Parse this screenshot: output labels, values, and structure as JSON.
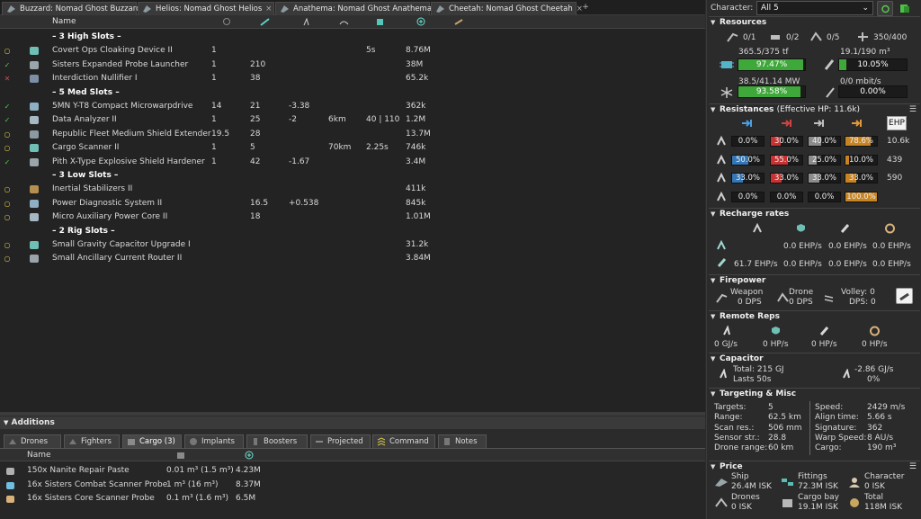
{
  "tabs": [
    {
      "label": "Buzzard: Nomad Ghost Buzzard",
      "icon": "ship-icon"
    },
    {
      "label": "Helios: Nomad Ghost Helios",
      "icon": "ship-icon"
    },
    {
      "label": "Anathema: Nomad Ghost Anathema",
      "icon": "ship-icon"
    },
    {
      "label": "Cheetah: Nomad Ghost Cheetah",
      "icon": "ship-icon"
    }
  ],
  "tab_close": "×",
  "tab_add": "+",
  "module_columns": {
    "name": "Name"
  },
  "modules": [
    {
      "state": "",
      "name": "– 3 High Slots –",
      "header": true
    },
    {
      "state": "online",
      "name": "Covert Ops Cloaking Device II",
      "qty": "1",
      "c1": "",
      "c2": "",
      "c3": "",
      "c4": "5s",
      "price": "8.76M"
    },
    {
      "state": "active",
      "name": "Sisters Expanded Probe Launcher",
      "qty": "1",
      "c1": "210",
      "c2": "",
      "c3": "",
      "c4": "",
      "price": "38M"
    },
    {
      "state": "offline",
      "name": "Interdiction Nullifier I",
      "qty": "1",
      "c1": "38",
      "c2": "",
      "c3": "",
      "c4": "",
      "price": "65.2k"
    },
    {
      "state": "",
      "name": "– 5 Med Slots –",
      "header": true
    },
    {
      "state": "active",
      "name": "5MN Y-T8 Compact Microwarpdrive",
      "qty": "14",
      "c1": "21",
      "c2": "-3.38",
      "c3": "",
      "c4": "",
      "price": "362k"
    },
    {
      "state": "active",
      "name": "Data Analyzer II",
      "qty": "1",
      "c1": "25",
      "c2": "-2",
      "c3": "6km",
      "c4": "40 | 110",
      "price": "1.2M"
    },
    {
      "state": "online",
      "name": "Republic Fleet Medium Shield Extender",
      "qty": "19.5",
      "c1": "28",
      "c2": "",
      "c3": "",
      "c4": "",
      "price": "13.7M"
    },
    {
      "state": "online",
      "name": "Cargo Scanner II",
      "qty": "1",
      "c1": "5",
      "c2": "",
      "c3": "70km",
      "c4": "2.25s",
      "price": "746k"
    },
    {
      "state": "active",
      "name": "Pith X-Type Explosive Shield Hardener",
      "qty": "1",
      "c1": "42",
      "c2": "-1.67",
      "c3": "",
      "c4": "",
      "price": "3.4M"
    },
    {
      "state": "",
      "name": "– 3 Low Slots –",
      "header": true
    },
    {
      "state": "online",
      "name": "Inertial Stabilizers II",
      "qty": "",
      "c1": "",
      "c2": "",
      "c3": "",
      "c4": "",
      "price": "411k"
    },
    {
      "state": "online",
      "name": "Power Diagnostic System II",
      "qty": "",
      "c1": "16.5",
      "c2": "+0.538",
      "c3": "",
      "c4": "",
      "price": "845k"
    },
    {
      "state": "online",
      "name": "Micro Auxiliary Power Core II",
      "qty": "",
      "c1": "18",
      "c2": "",
      "c3": "",
      "c4": "",
      "price": "1.01M"
    },
    {
      "state": "",
      "name": "– 2 Rig Slots –",
      "header": true
    },
    {
      "state": "online",
      "name": "Small Gravity Capacitor Upgrade I",
      "qty": "",
      "c1": "",
      "c2": "",
      "c3": "",
      "c4": "",
      "price": "31.2k"
    },
    {
      "state": "online",
      "name": "Small Ancillary Current Router II",
      "qty": "",
      "c1": "",
      "c2": "",
      "c3": "",
      "c4": "",
      "price": "3.84M"
    }
  ],
  "state_glyphs": {
    "online": "○",
    "active": "✓",
    "offline": "✕"
  },
  "additions": {
    "title": "Additions",
    "toggle": "▼",
    "tabs": [
      "Drones",
      "Fighters",
      "Cargo (3)",
      "Implants",
      "Boosters",
      "Projected",
      "Command",
      "Notes"
    ],
    "active_tab": "Cargo (3)",
    "columns": {
      "name": "Name"
    },
    "rows": [
      {
        "name": "150x Nanite Repair Paste",
        "volume": "0.01 m³ (1.5 m³)",
        "price": "4.23M"
      },
      {
        "name": "16x Sisters Combat Scanner Probe",
        "volume": "1 m³ (16 m³)",
        "price": "8.37M"
      },
      {
        "name": "16x Sisters Core Scanner Probe",
        "volume": "0.1 m³ (1.6 m³)",
        "price": "6.5M"
      }
    ]
  },
  "character": {
    "label": "Character:",
    "value": "All 5"
  },
  "resources": {
    "title": "Resources",
    "hardpoints": [
      {
        "icon": "turret-hardpoint-icon",
        "value": "0/1"
      },
      {
        "icon": "launcher-hardpoint-icon",
        "value": "0/2"
      },
      {
        "icon": "drone-bay-icon",
        "value": "0/5"
      },
      {
        "icon": "calibration-icon",
        "value": "350/400"
      }
    ],
    "cpu": {
      "text": "365.5/375 tf",
      "percent": "97.47%",
      "fill": 97.47
    },
    "pg": {
      "text": "38.5/41.14 MW",
      "percent": "93.58%",
      "fill": 93.58
    },
    "drone_bay": {
      "text": "19.1/190 m³",
      "percent": "10.05%",
      "fill": 10.05
    },
    "bandwidth": {
      "text": "0/0 mbit/s",
      "percent": "0.00%",
      "fill": 0
    }
  },
  "resistances": {
    "title": "Resistances",
    "ehp_label": "(Effective HP: 11.6k)",
    "ehp_button": "EHP",
    "menu": "☰",
    "rows": [
      {
        "layer": "shield",
        "values": [
          "0.0%",
          "30.0%",
          "40.0%",
          "78.6%"
        ],
        "fills": [
          0,
          30,
          40,
          78.6
        ],
        "hp": "10.6k"
      },
      {
        "layer": "armor",
        "values": [
          "50.0%",
          "55.0%",
          "25.0%",
          "10.0%"
        ],
        "fills": [
          50,
          55,
          25,
          10
        ],
        "hp": "439"
      },
      {
        "layer": "hull",
        "values": [
          "33.0%",
          "33.0%",
          "33.0%",
          "33.0%"
        ],
        "fills": [
          33,
          33,
          33,
          33
        ],
        "hp": "590"
      },
      {
        "layer": "damage-pattern",
        "values": [
          "0.0%",
          "0.0%",
          "0.0%",
          "100.0%"
        ],
        "fills": [
          0,
          0,
          0,
          100
        ],
        "hp": ""
      }
    ],
    "colors": [
      "#3577b5",
      "#c73232",
      "#8c8c8c",
      "#c98422"
    ]
  },
  "recharge": {
    "title": "Recharge rates",
    "rows": [
      {
        "values": [
          "0.0 EHP/s",
          "0.0 EHP/s",
          "0.0 EHP/s"
        ]
      },
      {
        "values": [
          "61.7 EHP/s",
          "0.0 EHP/s",
          "0.0 EHP/s",
          "0.0 EHP/s"
        ]
      }
    ]
  },
  "firepower": {
    "title": "Firepower",
    "weapon_label": "Weapon",
    "weapon_value": "0 DPS",
    "drone_label": "Drone",
    "drone_value": "0 DPS",
    "volley_label": "Volley: 0",
    "dps_label": "DPS: 0"
  },
  "remote_reps": {
    "title": "Remote Reps",
    "values": [
      "0 GJ/s",
      "0 HP/s",
      "0 HP/s",
      "0 HP/s"
    ]
  },
  "capacitor": {
    "title": "Capacitor",
    "total": "Total: 215 GJ",
    "lasts": "Lasts 50s",
    "rate": "-2.86 GJ/s",
    "rate_pct": "0%"
  },
  "targeting": {
    "title": "Targeting & Misc",
    "left": [
      {
        "label": "Targets:",
        "value": "5"
      },
      {
        "label": "Range:",
        "value": "62.5 km"
      },
      {
        "label": "Scan res.:",
        "value": "506 mm"
      },
      {
        "label": "Sensor str.:",
        "value": "28.8"
      },
      {
        "label": "Drone range:",
        "value": "60 km"
      }
    ],
    "right": [
      {
        "label": "Speed:",
        "value": "2429 m/s"
      },
      {
        "label": "Align time:",
        "value": "5.66 s"
      },
      {
        "label": "Signature:",
        "value": "362"
      },
      {
        "label": "Warp Speed:",
        "value": "8 AU/s"
      },
      {
        "label": "Cargo:",
        "value": "190 m³"
      }
    ]
  },
  "price": {
    "title": "Price",
    "items": [
      {
        "label": "Ship",
        "value": "26.4M ISK"
      },
      {
        "label": "Fittings",
        "value": "72.3M ISK"
      },
      {
        "label": "Character",
        "value": "0 ISK"
      },
      {
        "label": "Drones",
        "value": "0 ISK"
      },
      {
        "label": "Cargo bay",
        "value": "19.1M ISK"
      },
      {
        "label": "Total",
        "value": "118M ISK"
      }
    ]
  },
  "collapse_glyph": "▼"
}
